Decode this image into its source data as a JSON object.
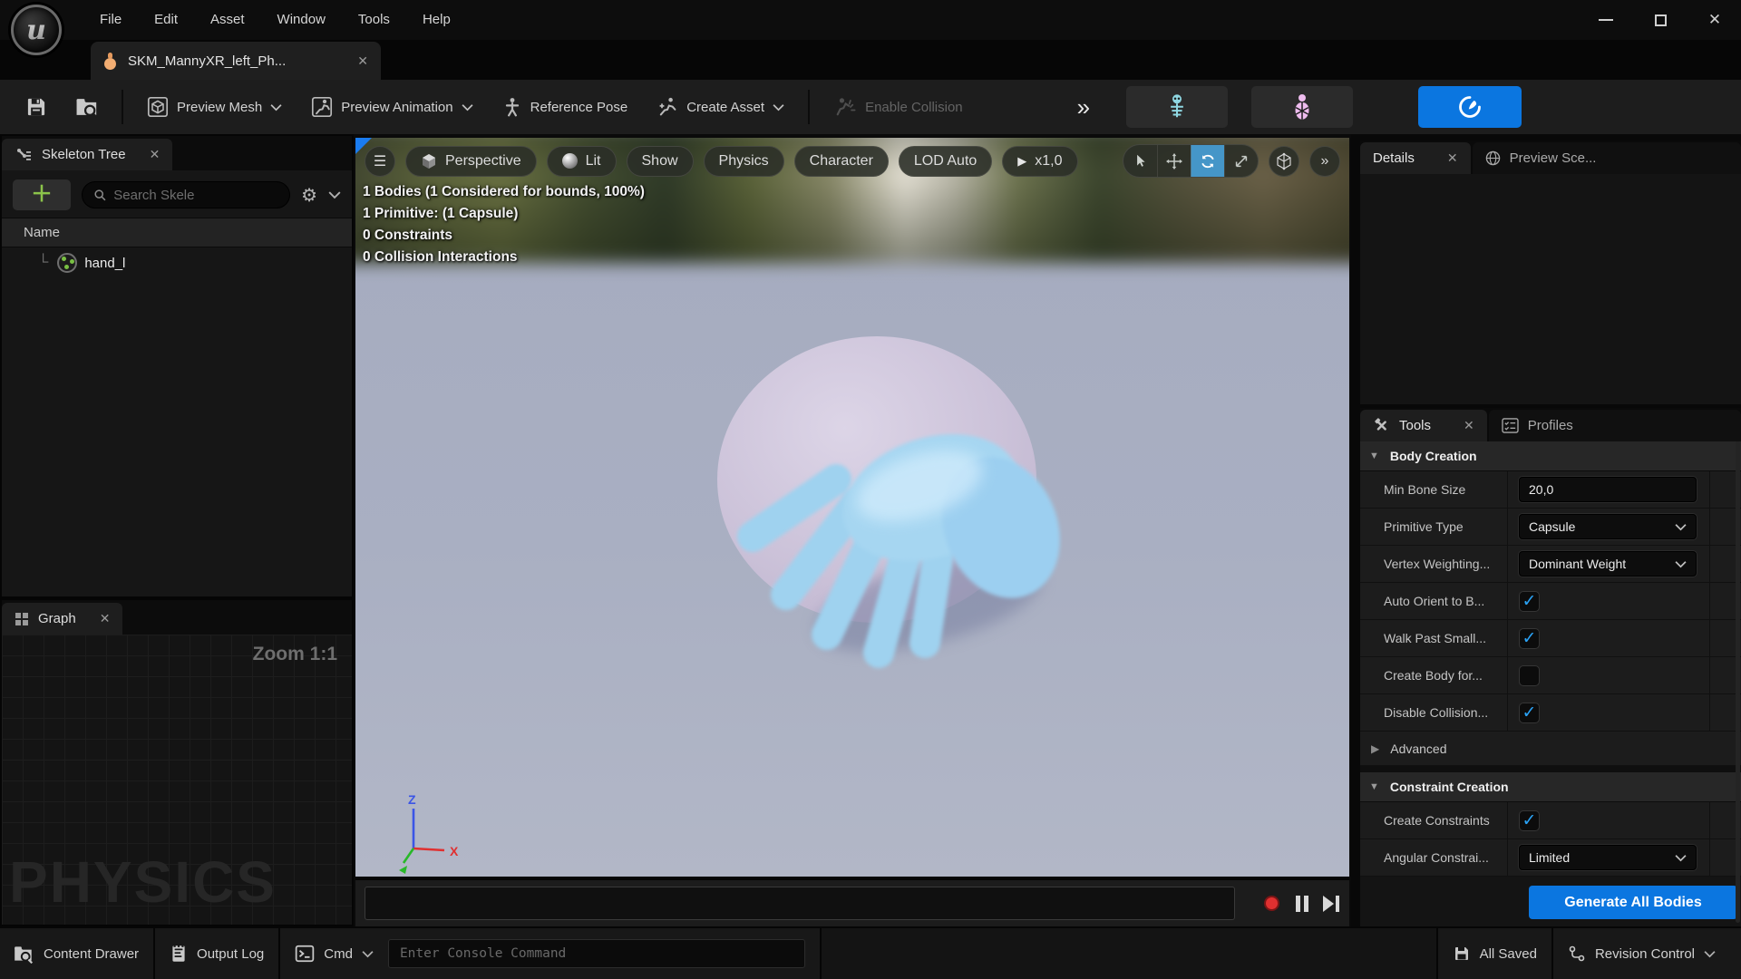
{
  "icons": {
    "close": "✕",
    "hamburger": "☰",
    "overflow": "»",
    "gear": "⚙",
    "play": "▶",
    "section_expanded": "▼",
    "section_collapsed": "▶",
    "check": "✓",
    "plus": "＋",
    "connector": "└"
  },
  "menu_bar": {
    "items": [
      "File",
      "Edit",
      "Asset",
      "Window",
      "Tools",
      "Help"
    ]
  },
  "asset_tab": {
    "label": "SKM_MannyXR_left_Ph..."
  },
  "main_toolbar": {
    "preview_mesh": "Preview Mesh",
    "preview_animation": "Preview Animation",
    "reference_pose": "Reference Pose",
    "create_asset": "Create Asset",
    "enable_collision": "Enable Collision"
  },
  "skeleton_tree": {
    "tab": "Skeleton Tree",
    "search_placeholder": "Search Skele",
    "column_header": "Name",
    "items": [
      {
        "label": "hand_l"
      }
    ]
  },
  "graph_panel": {
    "tab": "Graph",
    "zoom_label": "Zoom 1:1",
    "watermark": "PHYSICS"
  },
  "viewport": {
    "buttons": [
      "Perspective",
      "Lit",
      "Show",
      "Physics",
      "Character",
      "LOD Auto"
    ],
    "playback_speed": "x1,0",
    "stats": [
      "1 Bodies (1 Considered for bounds, 100%)",
      "1 Primitive: (1 Capsule)",
      "0 Constraints",
      "0 Collision Interactions"
    ],
    "axis": {
      "x": "X",
      "z": "Z"
    }
  },
  "details_panel": {
    "tab": "Details",
    "preview_scene_tab": "Preview Sce..."
  },
  "tools_panel": {
    "tab": "Tools",
    "profiles_tab": "Profiles",
    "body_creation": {
      "title": "Body Creation",
      "rows": [
        {
          "label": "Min Bone Size",
          "type": "input",
          "value": "20,0"
        },
        {
          "label": "Primitive Type",
          "type": "dropdown",
          "value": "Capsule"
        },
        {
          "label": "Vertex Weighting...",
          "type": "dropdown",
          "value": "Dominant Weight"
        },
        {
          "label": "Auto Orient to B...",
          "type": "checkbox",
          "checked": true
        },
        {
          "label": "Walk Past Small...",
          "type": "checkbox",
          "checked": true
        },
        {
          "label": "Create Body for...",
          "type": "checkbox",
          "checked": false
        },
        {
          "label": "Disable Collision...",
          "type": "checkbox",
          "checked": true
        }
      ],
      "advanced_label": "Advanced"
    },
    "constraint_creation": {
      "title": "Constraint Creation",
      "rows": [
        {
          "label": "Create Constraints",
          "type": "checkbox",
          "checked": true
        },
        {
          "label": "Angular Constrai...",
          "type": "dropdown",
          "value": "Limited"
        }
      ]
    },
    "generate_button": "Generate All Bodies"
  },
  "status_bar": {
    "content_drawer": "Content Drawer",
    "output_log": "Output Log",
    "cmd": "Cmd",
    "console_placeholder": "Enter Console Command",
    "all_saved": "All Saved",
    "revision_control": "Revision Control"
  },
  "colors": {
    "accent_blue": "#0b76e0",
    "checkbox_blue": "#2aa3f7",
    "plus_green": "#8bc34a",
    "tab_icon_orange": "#f2ad72",
    "skeleton_button_teal": "#8fd7e2",
    "anatomy_button_pink": "#eebcee",
    "viewport_sky": "#a9afc2",
    "hand_blue": "#9fd2ef",
    "capsule_lavender": "#ccc2d9",
    "axis_x_red": "#e03030",
    "axis_z_blue": "#3b55e6",
    "axis_y_green": "#28b828"
  }
}
